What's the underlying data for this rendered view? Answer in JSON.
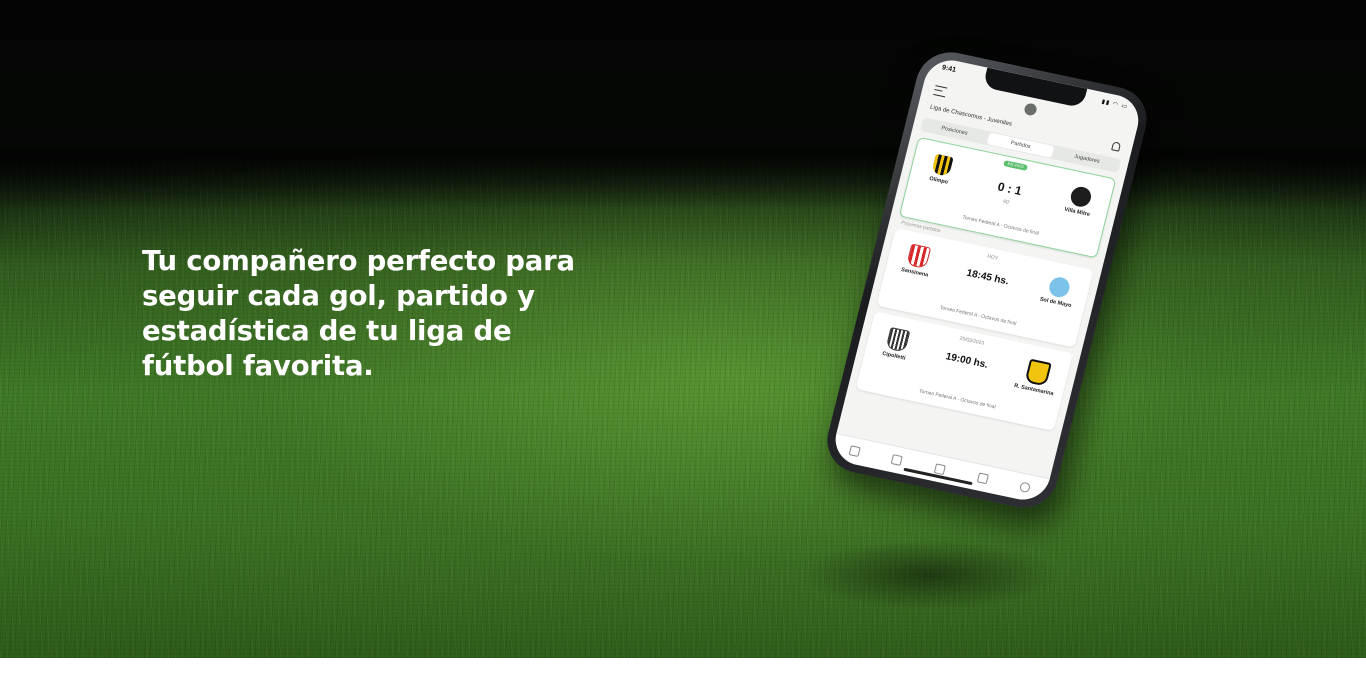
{
  "hero": {
    "headline": "Tu compañero perfecto para seguir cada gol, partido y estadística de tu liga de fútbol favorita."
  },
  "phone": {
    "status_time": "9:41",
    "league_title": "Liga de Chascomus - Juveniles",
    "tabs": [
      {
        "label": "Posiciones",
        "active": false
      },
      {
        "label": "Partidos",
        "active": true
      },
      {
        "label": "Jugadores",
        "active": false
      }
    ],
    "live_match": {
      "badge": "EN VIVO",
      "home_team": "Olimpo",
      "away_team": "Villa Mitre",
      "score": "0 : 1",
      "minute": "60'",
      "tournament": "Torneo Federal A - Octavos de final"
    },
    "upcoming_label": "Próximos partidos",
    "matches": [
      {
        "day": "HOY",
        "time": "18:45 hs.",
        "home_team": "Sansinena",
        "away_team": "Sol de Mayo",
        "tournament": "Torneo Federal A - Octavos de final"
      },
      {
        "day": "25/03/2023",
        "time": "19:00 hs.",
        "home_team": "Cipolletti",
        "away_team": "R. Santamarina",
        "tournament": "Torneo Federal A - Octavos de final"
      }
    ],
    "nav_icons": [
      "news-icon",
      "stats-icon",
      "cup-icon",
      "stadium-icon",
      "profile-icon"
    ]
  }
}
